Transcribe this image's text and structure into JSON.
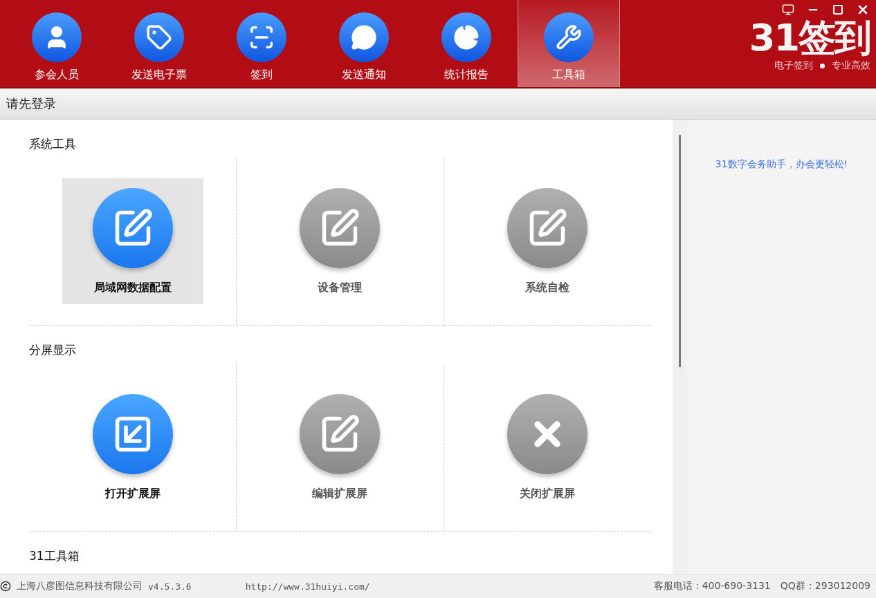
{
  "nav_tabs": [
    {
      "label": "参会人员",
      "kind": "user",
      "selected": false
    },
    {
      "label": "发送电子票",
      "kind": "tag",
      "selected": false
    },
    {
      "label": "签到",
      "kind": "scan",
      "selected": false
    },
    {
      "label": "发送通知",
      "kind": "chat",
      "selected": false
    },
    {
      "label": "统计报告",
      "kind": "pie",
      "selected": false
    },
    {
      "label": "工具箱",
      "kind": "wrench",
      "selected": true
    }
  ],
  "logo": {
    "title": "31签到",
    "slogan_left": "电子签到",
    "slogan_right": "专业高效"
  },
  "status_line": "请先登录",
  "sections": [
    {
      "title": "系统工具",
      "tools": [
        {
          "label": "局域网数据配置",
          "kind": "edit",
          "enabled": true,
          "selected": true
        },
        {
          "label": "设备管理",
          "kind": "edit",
          "enabled": false,
          "selected": false
        },
        {
          "label": "系统自检",
          "kind": "edit",
          "enabled": false,
          "selected": false
        }
      ]
    },
    {
      "title": "分屏显示",
      "tools": [
        {
          "label": "打开扩展屏",
          "kind": "export",
          "enabled": true,
          "selected": false
        },
        {
          "label": "编辑扩展屏",
          "kind": "edit",
          "enabled": false,
          "selected": false
        },
        {
          "label": "关闭扩展屏",
          "kind": "close",
          "enabled": false,
          "selected": false
        }
      ]
    },
    {
      "title": "31工具箱"
    }
  ],
  "side_panel": {
    "tagline": "31数字会务助手，办会更轻松!"
  },
  "footer": {
    "company": "上海八彦图信息科技有限公司",
    "version": "v4.5.3.6",
    "url": "http://www.31huiyi.com/",
    "phone": "客服电话：400-690-3131",
    "qq": "QQ群：293012009"
  }
}
